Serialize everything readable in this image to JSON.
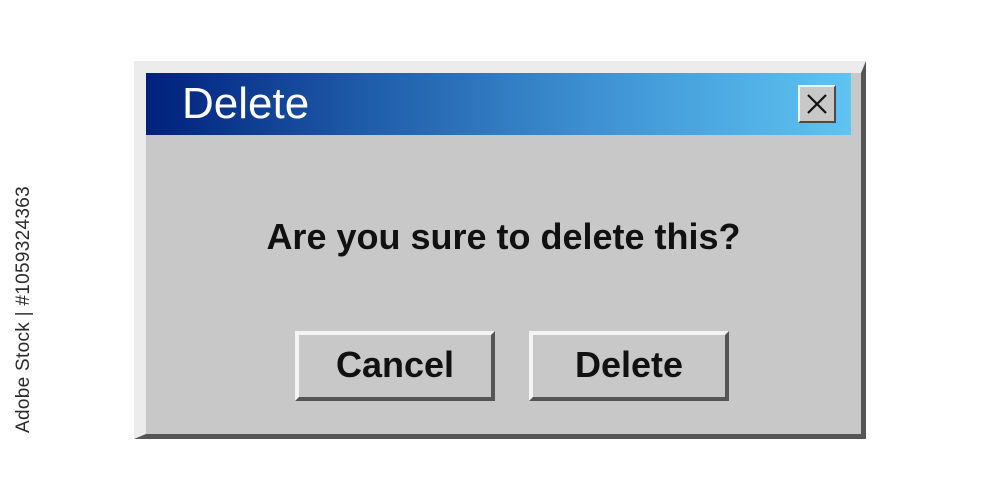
{
  "dialog": {
    "title": "Delete",
    "message": "Are you sure to delete this?",
    "buttons": {
      "cancel_label": "Cancel",
      "delete_label": "Delete"
    },
    "close_icon": "close-icon"
  },
  "watermark": {
    "side_text": "Adobe Stock | #1059324363"
  },
  "colors": {
    "titlebar_start": "#00207c",
    "titlebar_end": "#5ec4f2",
    "window_bg": "#c8c8c8",
    "title_text": "#ffffff"
  }
}
